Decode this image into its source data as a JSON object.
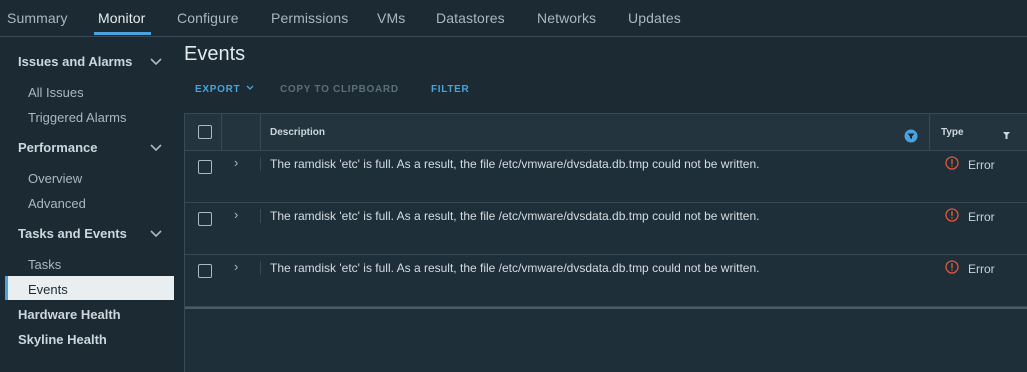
{
  "tabs": [
    {
      "label": "Summary",
      "active": false
    },
    {
      "label": "Monitor",
      "active": true
    },
    {
      "label": "Configure",
      "active": false
    },
    {
      "label": "Permissions",
      "active": false
    },
    {
      "label": "VMs",
      "active": false
    },
    {
      "label": "Datastores",
      "active": false
    },
    {
      "label": "Networks",
      "active": false
    },
    {
      "label": "Updates",
      "active": false
    }
  ],
  "sidebar": {
    "sections": [
      {
        "label": "Issues and Alarms",
        "items": [
          "All Issues",
          "Triggered Alarms"
        ]
      },
      {
        "label": "Performance",
        "items": [
          "Overview",
          "Advanced"
        ]
      },
      {
        "label": "Tasks and Events",
        "items": [
          "Tasks",
          "Events"
        ]
      }
    ],
    "active_item": "Events",
    "top_items": [
      "Hardware Health",
      "Skyline Health"
    ]
  },
  "main": {
    "title": "Events",
    "actions": {
      "export_label": "EXPORT",
      "copy_label": "COPY TO CLIPBOARD",
      "filter_label": "FILTER"
    },
    "columns": {
      "description": "Description",
      "type": "Type"
    },
    "rows": [
      {
        "description": "The ramdisk 'etc' is full. As a result, the file /etc/vmware/dvsdata.db.tmp could not be written.",
        "type": "Error"
      },
      {
        "description": "The ramdisk 'etc' is full. As a result, the file /etc/vmware/dvsdata.db.tmp could not be written.",
        "type": "Error"
      },
      {
        "description": "The ramdisk 'etc' is full. As a result, the file /etc/vmware/dvsdata.db.tmp could not be written.",
        "type": "Error"
      }
    ]
  },
  "colors": {
    "accent": "#4aa3df",
    "error": "#e2573a",
    "background": "#1b2a33"
  },
  "icons": {
    "expand_row": "chevron-right-icon",
    "section_toggle": "chevron-down-icon",
    "error": "error-circle-icon",
    "filter": "filter-icon",
    "sort": "sort-icon"
  }
}
